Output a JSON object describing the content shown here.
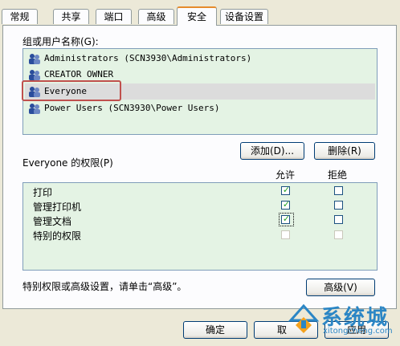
{
  "tabs": [
    {
      "label": "常规"
    },
    {
      "label": "共享"
    },
    {
      "label": "端口"
    },
    {
      "label": "高级"
    },
    {
      "label": "安全"
    },
    {
      "label": "设备设置"
    }
  ],
  "groups_label": "组或用户名称(G):",
  "users": [
    {
      "name": "Administrators (SCN3930\\Administrators)"
    },
    {
      "name": "CREATOR OWNER"
    },
    {
      "name": "Everyone"
    },
    {
      "name": "Power Users (SCN3930\\Power Users)"
    }
  ],
  "add_label": "添加(D)...",
  "remove_label": "删除(R)",
  "perm_label": "Everyone 的权限(P)",
  "allow_col": "允许",
  "deny_col": "拒绝",
  "permissions": [
    {
      "name": "打印",
      "allow": true,
      "deny": false
    },
    {
      "name": "管理打印机",
      "allow": true,
      "deny": false
    },
    {
      "name": "管理文档",
      "allow": true,
      "deny": false
    },
    {
      "name": "特别的权限",
      "allow": false,
      "deny": false
    }
  ],
  "advanced_hint": "特别权限或高级设置，请单击“高级”。",
  "advanced_label": "高级(V)",
  "ok_label": "确定",
  "cancel_label": "取",
  "apply_label": "应用",
  "watermark": {
    "cn": "系统城",
    "en": "xitongcheng.com"
  },
  "colors": {
    "selection_box": "#c0504d",
    "list_bg": "#e4f3e4",
    "check": "#21a121"
  }
}
